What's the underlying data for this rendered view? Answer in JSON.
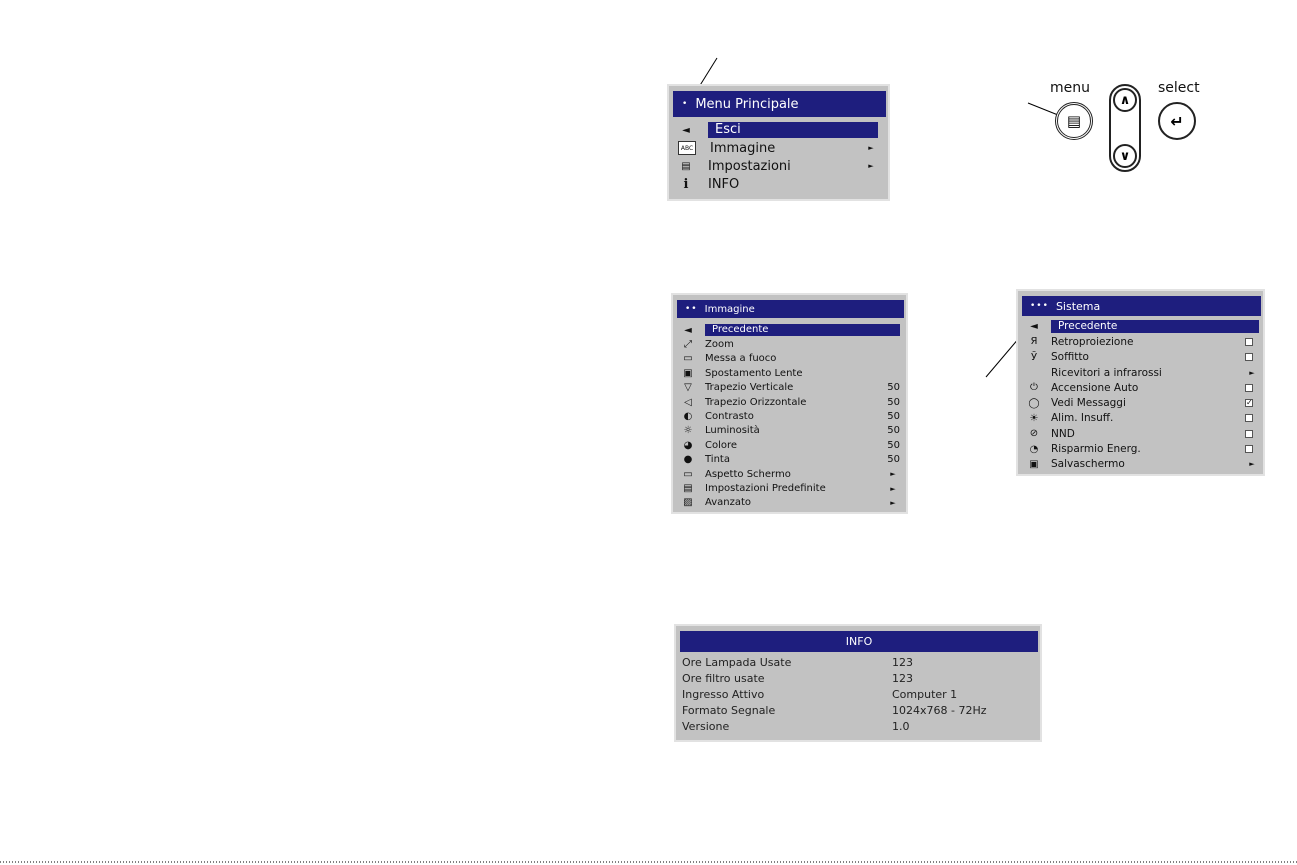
{
  "main_menu": {
    "title": "Menu Principale",
    "title_dot": "•",
    "items": [
      {
        "icon": "back-arrow-icon",
        "glyph": "◄",
        "label": "Esci",
        "selected": true
      },
      {
        "icon": "abc-image-icon",
        "glyph": "ABC",
        "label": "Immagine",
        "arrow": "►"
      },
      {
        "icon": "settings-doc-icon",
        "glyph": "▤",
        "label": "Impostazioni",
        "arrow": "►"
      },
      {
        "icon": "info-icon",
        "glyph": "i",
        "label": "INFO"
      }
    ]
  },
  "keypad": {
    "menu_label": "menu",
    "select_label": "select",
    "menu_glyph": "▤",
    "select_glyph": "↵",
    "up_glyph": "∧",
    "down_glyph": "∨"
  },
  "image_menu": {
    "title": "Immagine",
    "title_dots": "••",
    "items": [
      {
        "glyph": "◄",
        "label": "Precedente",
        "selected": true
      },
      {
        "glyph": "⤢",
        "label": "Zoom"
      },
      {
        "glyph": "▭",
        "label": "Messa a fuoco"
      },
      {
        "glyph": "▣",
        "label": "Spostamento Lente"
      },
      {
        "glyph": "▽",
        "label": "Trapezio Verticale",
        "value": "50"
      },
      {
        "glyph": "◁",
        "label": "Trapezio Orizzontale",
        "value": "50"
      },
      {
        "glyph": "◐",
        "label": "Contrasto",
        "value": "50"
      },
      {
        "glyph": "☼",
        "label": "Luminosità",
        "value": "50"
      },
      {
        "glyph": "◕",
        "label": "Colore",
        "value": "50"
      },
      {
        "glyph": "●",
        "label": "Tinta",
        "value": "50"
      },
      {
        "glyph": "▭",
        "label": "Aspetto Schermo",
        "arrow": "►"
      },
      {
        "glyph": "▤",
        "label": "Impostazioni Predefinite",
        "arrow": "►"
      },
      {
        "glyph": "▨",
        "label": "Avanzato",
        "arrow": "►"
      }
    ]
  },
  "system_menu": {
    "title": "Sistema",
    "title_dots": "•••",
    "items": [
      {
        "glyph": "◄",
        "label": "Precedente",
        "selected": true
      },
      {
        "glyph": "Я",
        "label": "Retroproiezione",
        "check": ""
      },
      {
        "glyph": "Ӯ",
        "label": "Soffitto",
        "check": ""
      },
      {
        "glyph": "",
        "label": "Ricevitori a infrarossi",
        "arrow": "►"
      },
      {
        "glyph": "⏻",
        "label": "Accensione Auto",
        "check": ""
      },
      {
        "glyph": "◯",
        "label": "Vedi Messaggi",
        "check": "✓"
      },
      {
        "glyph": "☀",
        "label": "Alim. Insuff.",
        "check": ""
      },
      {
        "glyph": "⊘",
        "label": "NND",
        "check": ""
      },
      {
        "glyph": "◔",
        "label": "Risparmio Energ.",
        "check": ""
      },
      {
        "glyph": "▣",
        "label": "Salvaschermo",
        "arrow": "►"
      }
    ]
  },
  "info_panel": {
    "title": "INFO",
    "rows": [
      {
        "key": "Ore Lampada Usate",
        "value": "123"
      },
      {
        "key": "Ore filtro usate",
        "value": "123"
      },
      {
        "key": "Ingresso Attivo",
        "value": "Computer 1"
      },
      {
        "key": "Formato Segnale",
        "value": "1024x768 - 72Hz"
      },
      {
        "key": "Versione",
        "value": "1.0"
      }
    ]
  },
  "colors": {
    "title_bar": "#1e1e7e",
    "panel": "#c2c2c2"
  }
}
